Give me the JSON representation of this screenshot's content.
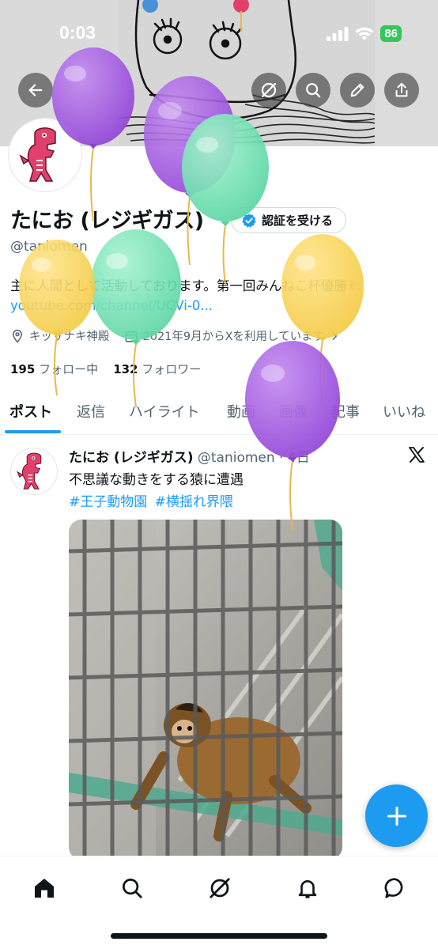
{
  "status_bar": {
    "time": "0:03",
    "battery": "86"
  },
  "header": {
    "back_icon": "arrow-left-icon",
    "grok_icon": "grok-icon",
    "search_icon": "search-icon",
    "edit_icon": "pencil-icon",
    "share_icon": "share-icon"
  },
  "profile": {
    "name": "たにお (レジギガス)",
    "verify_label": "認証を受ける",
    "handle": "@taniomen",
    "bio": "主に人間として活動しております。第一回みんねこ杯優勝✌",
    "link": "youtube.com/channel/UCVi-0...",
    "location": "キッサナキ神殿",
    "joined": "2021年9月からXを利用しています",
    "following_count": "195",
    "following_label": "フォロー中",
    "followers_count": "132",
    "followers_label": "フォロワー"
  },
  "tabs": [
    "ポスト",
    "返信",
    "ハイライト",
    "動画",
    "画像",
    "記事",
    "いいね"
  ],
  "post": {
    "name": "たにお (レジギガス)",
    "handle": "@taniomen",
    "time": "4日",
    "text": "不思議な動きをする猿に遭遇",
    "tags": [
      "#王子動物園",
      "#横揺れ界隈"
    ]
  },
  "bottom_nav": [
    "home-icon",
    "search-icon",
    "grok-icon",
    "bell-icon",
    "message-icon"
  ],
  "colors": {
    "accent": "#1d9bf0",
    "battery": "#34c759",
    "text": "#0f1419",
    "secondary": "#536471"
  }
}
